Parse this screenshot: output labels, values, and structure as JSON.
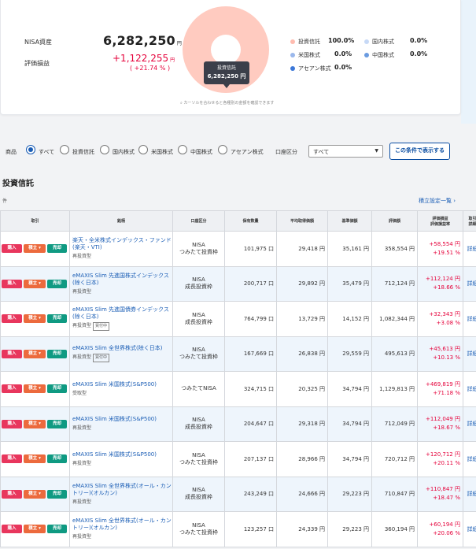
{
  "summary": {
    "nisa_label": "NISA資産",
    "nisa_value": "6,282,250",
    "yen": "円",
    "pl_label": "評価損益",
    "pl_value": "+1,122,255",
    "pl_pct": "( +21.74 % )",
    "tooltip_title": "投資信託",
    "tooltip_value": "6,282,250 円",
    "hint": "カーソルを合わせると各種別の金額を確認できます"
  },
  "legend": [
    {
      "label": "投資信託",
      "pct": "100.0%",
      "color": "#ffbcb0"
    },
    {
      "label": "国内株式",
      "pct": "0.0%",
      "color": "#c7d9f6"
    },
    {
      "label": "米国株式",
      "pct": "0.0%",
      "color": "#9bb8ec"
    },
    {
      "label": "中国株式",
      "pct": "0.0%",
      "color": "#6a9be0"
    },
    {
      "label": "アセアン株式",
      "pct": "0.0%",
      "color": "#3c78d8"
    }
  ],
  "filter": {
    "product_label": "商品",
    "radios": [
      "すべて",
      "投資信託",
      "国内株式",
      "米国株式",
      "中国株式",
      "アセアン株式"
    ],
    "selected": "すべて",
    "account_label": "口座区分",
    "account_value": "すべて",
    "button": "この条件で表示する"
  },
  "section": {
    "title": "投資信託",
    "count": "件",
    "link": "積立設定一覧 ›"
  },
  "table": {
    "headers": [
      "取引",
      "銘柄",
      "口座区分",
      "保有数量",
      "平均取得価額",
      "基準価額",
      "評価額",
      "評価損益\n評価損益率",
      "取引\n詳細"
    ],
    "buttons": {
      "buy": "購入",
      "tsumi": "積立 ▾",
      "sell": "売却"
    },
    "detail": "詳細",
    "rows": [
      {
        "fund": "楽天・全米株式インデックス・ファンド(楽天・VTI)",
        "kind": "再投資型",
        "tag": "",
        "acct1": "NISA",
        "acct2": "つみたて投資枠",
        "qty": "101,975 口",
        "avg": "29,418 円",
        "base": "35,161 円",
        "value": "358,554 円",
        "pl": "+58,554 円",
        "plpct": "+19.51 %"
      },
      {
        "fund": "eMAXIS Slim 先進国株式インデックス(除く日本)",
        "kind": "再投資型",
        "tag": "",
        "acct1": "NISA",
        "acct2": "成長投資枠",
        "qty": "200,717 口",
        "avg": "29,892 円",
        "base": "35,479 円",
        "value": "712,124 円",
        "pl": "+112,124 円",
        "plpct": "+18.66 %"
      },
      {
        "fund": "eMAXIS Slim 先進国債券インデックス(除く日本)",
        "kind": "再投資型",
        "tag": "買付中",
        "acct1": "NISA",
        "acct2": "成長投資枠",
        "qty": "764,799 口",
        "avg": "13,729 円",
        "base": "14,152 円",
        "value": "1,082,344 円",
        "pl": "+32,343 円",
        "plpct": "+3.08 %"
      },
      {
        "fund": "eMAXIS Slim 全世界株式(除く日本)",
        "kind": "再投資型",
        "tag": "買付中",
        "acct1": "NISA",
        "acct2": "つみたて投資枠",
        "qty": "167,669 口",
        "avg": "26,838 円",
        "base": "29,559 円",
        "value": "495,613 円",
        "pl": "+45,613 円",
        "plpct": "+10.13 %"
      },
      {
        "fund": "eMAXIS Slim 米国株式(S&P500)",
        "kind": "受取型",
        "tag": "",
        "acct1": "つみたてNISA",
        "acct2": "",
        "qty": "324,715 口",
        "avg": "20,325 円",
        "base": "34,794 円",
        "value": "1,129,813 円",
        "pl": "+469,819 円",
        "plpct": "+71.18 %"
      },
      {
        "fund": "eMAXIS Slim 米国株式(S&P500)",
        "kind": "再投資型",
        "tag": "",
        "acct1": "NISA",
        "acct2": "成長投資枠",
        "qty": "204,647 口",
        "avg": "29,318 円",
        "base": "34,794 円",
        "value": "712,049 円",
        "pl": "+112,049 円",
        "plpct": "+18.67 %"
      },
      {
        "fund": "eMAXIS Slim 米国株式(S&P500)",
        "kind": "再投資型",
        "tag": "",
        "acct1": "NISA",
        "acct2": "つみたて投資枠",
        "qty": "207,137 口",
        "avg": "28,966 円",
        "base": "34,794 円",
        "value": "720,712 円",
        "pl": "+120,712 円",
        "plpct": "+20.11 %"
      },
      {
        "fund": "eMAXIS Slim 全世界株式(オール・カントリー)(オルカン)",
        "kind": "再投資型",
        "tag": "",
        "acct1": "NISA",
        "acct2": "成長投資枠",
        "qty": "243,249 口",
        "avg": "24,666 円",
        "base": "29,223 円",
        "value": "710,847 円",
        "pl": "+110,847 円",
        "plpct": "+18.47 %"
      },
      {
        "fund": "eMAXIS Slim 全世界株式(オール・カントリー)(オルカン)",
        "kind": "再投資型",
        "tag": "",
        "acct1": "NISA",
        "acct2": "つみたて投資枠",
        "qty": "123,257 口",
        "avg": "24,339 円",
        "base": "29,223 円",
        "value": "360,194 円",
        "pl": "+60,194 円",
        "plpct": "+20.06 %"
      }
    ]
  }
}
